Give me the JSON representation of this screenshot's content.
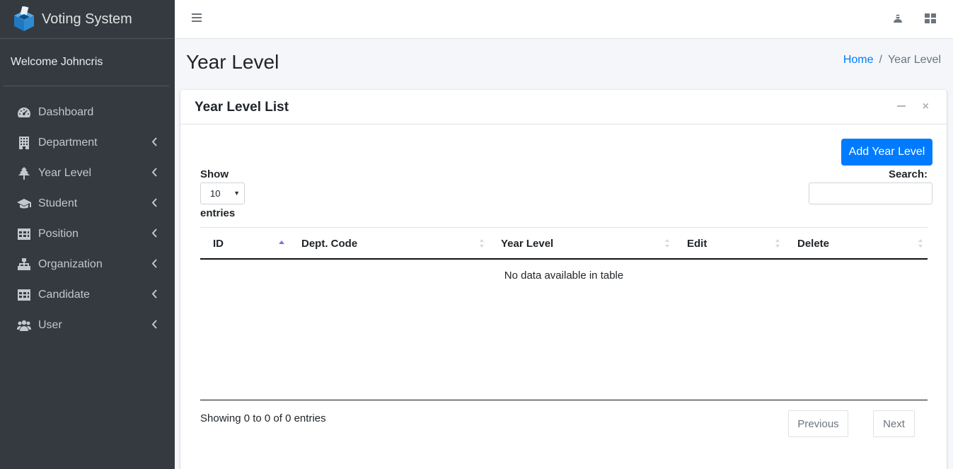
{
  "brand": {
    "name": "Voting System",
    "logo_icon": "ballot-box-icon",
    "accent": "#2d8bd1"
  },
  "user_panel": {
    "welcome": "Welcome Johncris"
  },
  "sidebar": {
    "items": [
      {
        "label": "Dashboard",
        "icon": "dashboard-icon",
        "has_submenu": false
      },
      {
        "label": "Department",
        "icon": "building-icon",
        "has_submenu": true
      },
      {
        "label": "Year Level",
        "icon": "tree-icon",
        "has_submenu": true
      },
      {
        "label": "Student",
        "icon": "graduation-cap-icon",
        "has_submenu": true
      },
      {
        "label": "Position",
        "icon": "table-icon",
        "has_submenu": true
      },
      {
        "label": "Organization",
        "icon": "sitemap-icon",
        "has_submenu": true
      },
      {
        "label": "Candidate",
        "icon": "table-icon",
        "has_submenu": true
      },
      {
        "label": "User",
        "icon": "users-icon",
        "has_submenu": true
      }
    ]
  },
  "header": {
    "title": "Year Level",
    "breadcrumb": {
      "home": "Home",
      "separator": "/",
      "current": "Year Level"
    }
  },
  "card": {
    "title": "Year Level List",
    "add_button": "Add Year Level",
    "show_label": "Show",
    "entries_label": "entries",
    "page_length": "10",
    "search_label": "Search:",
    "search_value": ""
  },
  "table": {
    "columns": [
      "ID",
      "Dept. Code",
      "Year Level",
      "Edit",
      "Delete"
    ],
    "sorted_column": "ID",
    "sort_direction": "ascending",
    "empty_message": "No data available in table"
  },
  "pagination": {
    "info": "Showing 0 to 0 of 0 entries",
    "previous": "Previous",
    "next": "Next"
  },
  "colors": {
    "sidebar_bg": "#343a40",
    "primary": "#007bff",
    "page_bg": "#f4f6f9"
  }
}
